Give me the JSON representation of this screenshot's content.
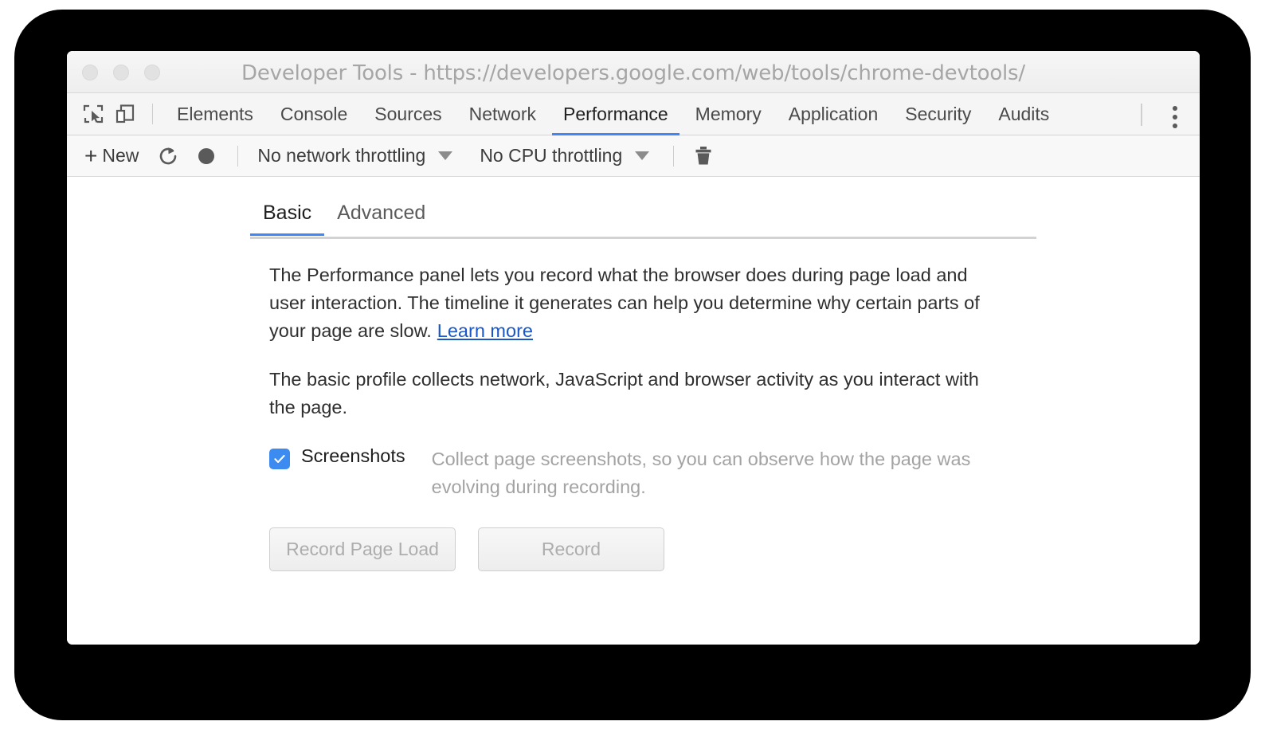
{
  "window": {
    "title": "Developer Tools - https://developers.google.com/web/tools/chrome-devtools/",
    "traffic_lights": [
      "close",
      "minimize",
      "zoom"
    ]
  },
  "devtools_tabs": {
    "inspect_icon": "inspect-element-icon",
    "device_icon": "device-toolbar-icon",
    "overflow_icon": "more-vertical-icon",
    "items": [
      {
        "label": "Elements",
        "active": false
      },
      {
        "label": "Console",
        "active": false
      },
      {
        "label": "Sources",
        "active": false
      },
      {
        "label": "Network",
        "active": false
      },
      {
        "label": "Performance",
        "active": true
      },
      {
        "label": "Memory",
        "active": false
      },
      {
        "label": "Application",
        "active": false
      },
      {
        "label": "Security",
        "active": false
      },
      {
        "label": "Audits",
        "active": false
      }
    ]
  },
  "perf_toolbar": {
    "new_label": "New",
    "plus_glyph": "+",
    "reload_icon": "reload-icon",
    "record_icon": "record-circle-icon",
    "network_throttling": "No network throttling",
    "cpu_throttling": "No CPU throttling",
    "clear_icon": "trash-icon"
  },
  "panel": {
    "subtabs": [
      {
        "label": "Basic",
        "active": true
      },
      {
        "label": "Advanced",
        "active": false
      }
    ],
    "paragraph_one": "The Performance panel lets you record what the browser does during page load and user interaction. The timeline it generates can help you determine why certain parts of your page are slow.",
    "learn_more": "Learn more",
    "paragraph_two": "The basic profile collects network, JavaScript and browser activity as you interact with the page.",
    "screenshots": {
      "checked": true,
      "label": "Screenshots",
      "description": "Collect page screenshots, so you can observe how the page was evolving during recording."
    },
    "buttons": [
      {
        "label": "Record Page Load",
        "disabled": true
      },
      {
        "label": "Record",
        "disabled": true
      }
    ]
  },
  "colors": {
    "accent_blue": "#4285f4",
    "checkbox_blue": "#3b8bf0",
    "link_blue": "#1a56c5",
    "backdrop_black": "#000000",
    "muted_gray": "#a3a3a3"
  }
}
